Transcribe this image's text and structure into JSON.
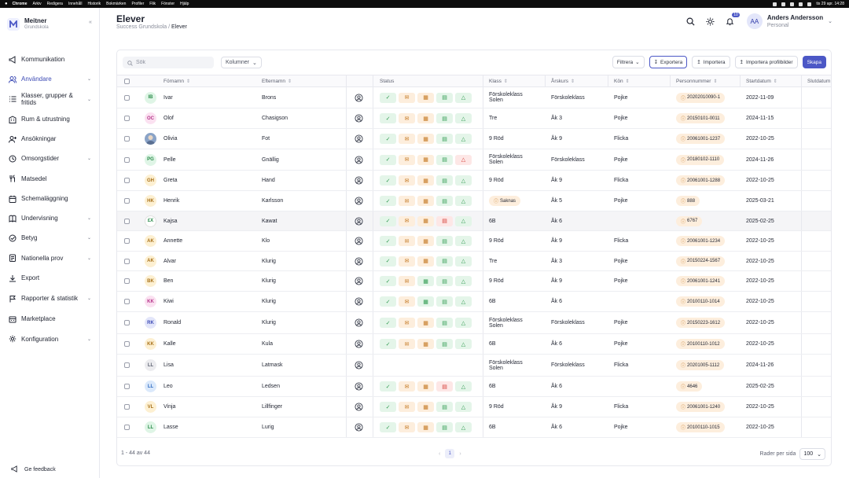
{
  "menubar": {
    "app": "Chrome",
    "items": [
      "Arkiv",
      "Redigera",
      "Innehåll",
      "Historik",
      "Bokmärken",
      "Profiler",
      "Flik",
      "Fönster",
      "Hjälp"
    ],
    "datetime": "tis 29 apr. 14:28"
  },
  "sidebar": {
    "brand_name": "Meitner",
    "brand_sub": "Grundskola",
    "items": [
      {
        "label": "Kommunikation",
        "icon": "megaphone-icon",
        "chevron": false,
        "active": false
      },
      {
        "label": "Användare",
        "icon": "users-icon",
        "chevron": true,
        "active": true
      },
      {
        "label": "Klasser, grupper & fritids",
        "icon": "list-icon",
        "chevron": true,
        "active": false
      },
      {
        "label": "Rum & utrustning",
        "icon": "building-icon",
        "chevron": false,
        "active": false
      },
      {
        "label": "Ansökningar",
        "icon": "user-plus-icon",
        "chevron": false,
        "active": false
      },
      {
        "label": "Omsorgstider",
        "icon": "clock-icon",
        "chevron": true,
        "active": false
      },
      {
        "label": "Matsedel",
        "icon": "cutlery-icon",
        "chevron": false,
        "active": false
      },
      {
        "label": "Schemaläggning",
        "icon": "calendar-icon",
        "chevron": false,
        "active": false
      },
      {
        "label": "Undervisning",
        "icon": "book-icon",
        "chevron": true,
        "active": false
      },
      {
        "label": "Betyg",
        "icon": "grade-icon",
        "chevron": true,
        "active": false
      },
      {
        "label": "Nationella prov",
        "icon": "exam-icon",
        "chevron": true,
        "active": false
      },
      {
        "label": "Export",
        "icon": "download-icon",
        "chevron": false,
        "active": false
      },
      {
        "label": "Rapporter & statistik",
        "icon": "flag-icon",
        "chevron": true,
        "active": false
      },
      {
        "label": "Marketplace",
        "icon": "store-icon",
        "chevron": false,
        "active": false
      },
      {
        "label": "Konfiguration",
        "icon": "gear-icon",
        "chevron": true,
        "active": false
      }
    ],
    "feedback": "Ge feedback"
  },
  "header": {
    "title": "Elever",
    "breadcrumb_root": "Success Grundskola",
    "breadcrumb_current": "Elever",
    "notif_count": "10",
    "user_initials": "AA",
    "user_name": "Anders Andersson",
    "user_role": "Personal"
  },
  "toolbar": {
    "search_placeholder": "Sök",
    "columns_label": "Kolumner",
    "filter_label": "Filtrera",
    "export_label": "Exportera",
    "import_label": "Importera",
    "import_pics_label": "Importera profilbilder",
    "create_label": "Skapa"
  },
  "columns": {
    "firstname": "Förnamn",
    "lastname": "Efternamn",
    "status": "Status",
    "klass": "Klass",
    "arskurs": "Årskurs",
    "kon": "Kön",
    "personnummer": "Personnummer",
    "startdatum": "Startdatum",
    "slutdatum": "Slutdatum"
  },
  "colors": {
    "accent": "#4c58c6",
    "ok": "#2e9a4e",
    "warn": "#c2751d",
    "error": "#d43b32"
  },
  "rows": [
    {
      "initials": "IB",
      "avbg": "#dff5e6",
      "avfg": "#2a8b4a",
      "first": "Ivar",
      "last": "Brons",
      "status": [
        "ok",
        "warn",
        "warn",
        "ok",
        "ok"
      ],
      "klass": "Förskoleklass Solen",
      "arskurs": "Förskoleklass",
      "kon": "Pojke",
      "pnr": "20202010090-1",
      "start": "2022-11-09",
      "h": 27
    },
    {
      "initials": "OC",
      "avbg": "#fbe1f1",
      "avfg": "#b5358a",
      "first": "Olof",
      "last": "Chasigson",
      "status": [
        "ok",
        "warn",
        "warn",
        "ok",
        "ok"
      ],
      "klass": "Tre",
      "arskurs": "Åk 3",
      "kon": "Pojke",
      "pnr": "20150101-0011",
      "start": "2024-11-15",
      "h": 26
    },
    {
      "initials": "",
      "avbg": "#8aa3c7",
      "avfg": "#fff",
      "first": "Olivia",
      "last": "Fot",
      "status": [
        "ok",
        "warn",
        "warn",
        "ok",
        "ok"
      ],
      "klass": "9 Röd",
      "arskurs": "Åk 9",
      "kon": "Flicka",
      "pnr": "20061001-1237",
      "start": "2022-10-25",
      "h": 26
    },
    {
      "initials": "PG",
      "avbg": "#dff5e6",
      "avfg": "#2a8b4a",
      "first": "Pelle",
      "last": "Gnällig",
      "status": [
        "ok",
        "warn",
        "warn",
        "ok",
        "err"
      ],
      "klass": "Förskoleklass Solen",
      "arskurs": "Förskoleklass",
      "kon": "Pojke",
      "pnr": "20180102-1110",
      "start": "2024-11-26",
      "h": 27
    },
    {
      "initials": "GH",
      "avbg": "#fdf0d2",
      "avfg": "#a8711a",
      "first": "Greta",
      "last": "Hand",
      "status": [
        "ok",
        "warn",
        "warn",
        "ok",
        "ok"
      ],
      "klass": "9 Röd",
      "arskurs": "Åk 9",
      "kon": "Flicka",
      "pnr": "20061001-1288",
      "start": "2022-10-25",
      "h": 26
    },
    {
      "initials": "HK",
      "avbg": "#fdf0d2",
      "avfg": "#a8711a",
      "first": "Henrik",
      "last": "Karlsson",
      "status": [
        "ok",
        "warn",
        "warn",
        "ok",
        "ok"
      ],
      "klass": "Saknas",
      "arskurs": "Åk 5",
      "kon": "Pojke",
      "pnr": "888",
      "start": "2025-03-21",
      "h": 26
    },
    {
      "initials": "£X",
      "avbg": "#ffffff",
      "avfg": "#2a8b4a",
      "first": "Kajsa",
      "last": "Kawat",
      "status": [
        "ok",
        "warn",
        "warn",
        "err",
        "ok"
      ],
      "klass": "6B",
      "arskurs": "Åk 6",
      "kon": "",
      "pnr": "6767",
      "start": "2025-02-25",
      "h": 25,
      "hl": true
    },
    {
      "initials": "AK",
      "avbg": "#fdf0d2",
      "avfg": "#a8711a",
      "first": "Annette",
      "last": "Klo",
      "status": [
        "ok",
        "warn",
        "warn",
        "ok",
        "ok"
      ],
      "klass": "9 Röd",
      "arskurs": "Åk 9",
      "kon": "Flicka",
      "pnr": "20061001-1234",
      "start": "2022-10-25",
      "h": 26
    },
    {
      "initials": "AK",
      "avbg": "#fdf0d2",
      "avfg": "#a8711a",
      "first": "Alvar",
      "last": "Klurig",
      "status": [
        "ok",
        "warn",
        "warn",
        "ok",
        "ok"
      ],
      "klass": "Tre",
      "arskurs": "Åk 3",
      "kon": "Pojke",
      "pnr": "20150224-1567",
      "start": "2022-10-25",
      "h": 25
    },
    {
      "initials": "BK",
      "avbg": "#fdf0d2",
      "avfg": "#a8711a",
      "first": "Ben",
      "last": "Klurig",
      "status": [
        "ok",
        "warn",
        "ok",
        "ok",
        "ok"
      ],
      "klass": "9 Röd",
      "arskurs": "Åk 9",
      "kon": "Pojke",
      "pnr": "20061001-1241",
      "start": "2022-10-25",
      "h": 26
    },
    {
      "initials": "KK",
      "avbg": "#fbe1f1",
      "avfg": "#b5358a",
      "first": "Kiwi",
      "last": "Klurig",
      "status": [
        "ok",
        "warn",
        "ok",
        "ok",
        "ok"
      ],
      "klass": "6B",
      "arskurs": "Åk 6",
      "kon": "",
      "pnr": "20100110-1014",
      "start": "2022-10-25",
      "h": 26
    },
    {
      "initials": "RK",
      "avbg": "#e3e6fa",
      "avfg": "#3d4bb5",
      "first": "Ronald",
      "last": "Klurig",
      "status": [
        "ok",
        "warn",
        "warn",
        "ok",
        "ok"
      ],
      "klass": "Förskoleklass Solen",
      "arskurs": "Förskoleklass",
      "kon": "Pojke",
      "pnr": "20150223-1612",
      "start": "2022-10-25",
      "h": 28
    },
    {
      "initials": "KK",
      "avbg": "#fdf0d2",
      "avfg": "#a8711a",
      "first": "Kalle",
      "last": "Kula",
      "status": [
        "ok",
        "warn",
        "warn",
        "ok",
        "ok"
      ],
      "klass": "6B",
      "arskurs": "Åk 6",
      "kon": "Pojke",
      "pnr": "20100110-1012",
      "start": "2022-10-25",
      "h": 26
    },
    {
      "initials": "LL",
      "avbg": "#ececef",
      "avfg": "#5f6372",
      "first": "Lisa",
      "last": "Latmask",
      "status": [],
      "klass": "Förskoleklass Solen",
      "arskurs": "Förskoleklass",
      "kon": "Flicka",
      "pnr": "20201005-1112",
      "start": "2024-11-26",
      "h": 28
    },
    {
      "initials": "LL",
      "avbg": "#dbe9fb",
      "avfg": "#2f6bc0",
      "first": "Leo",
      "last": "Ledsen",
      "status": [
        "ok",
        "warn",
        "warn",
        "err",
        "ok"
      ],
      "klass": "6B",
      "arskurs": "Åk 6",
      "kon": "",
      "pnr": "4646",
      "start": "2025-02-25",
      "h": 26
    },
    {
      "initials": "VL",
      "avbg": "#fdf0d2",
      "avfg": "#a8711a",
      "first": "Vinja",
      "last": "Lillfinger",
      "status": [
        "ok",
        "warn",
        "warn",
        "ok",
        "ok"
      ],
      "klass": "9 Röd",
      "arskurs": "Åk 9",
      "kon": "Flicka",
      "pnr": "20061001-1240",
      "start": "2022-10-25",
      "h": 26
    },
    {
      "initials": "LL",
      "avbg": "#dff5e6",
      "avfg": "#2a8b4a",
      "first": "Lasse",
      "last": "Lurig",
      "status": [
        "ok",
        "warn",
        "warn",
        "ok",
        "ok"
      ],
      "klass": "6B",
      "arskurs": "Åk 6",
      "kon": "Pojke",
      "pnr": "20100110-1015",
      "start": "2022-10-25",
      "h": 26
    }
  ],
  "footer": {
    "count": "1 - 44 av 44",
    "page": "1",
    "rows_per_page_label": "Rader per sida",
    "rows_per_page": "100"
  }
}
